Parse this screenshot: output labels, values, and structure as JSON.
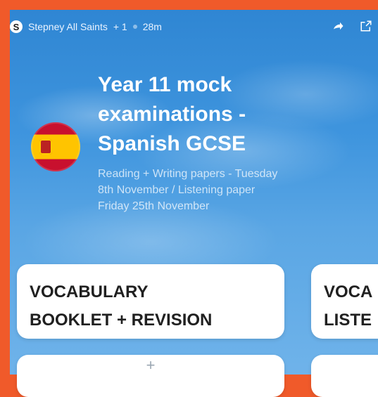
{
  "header": {
    "school": "Stepney All Saints",
    "member_badge": "+ 1",
    "time_ago": "28m"
  },
  "icons": [
    "share-icon",
    "open-external-icon"
  ],
  "post": {
    "title_line1": "Year 11 mock",
    "title_line2": "examinations -",
    "title_line3": "Spanish GCSE",
    "subtitle_line1": "Reading + Writing papers - Tuesday",
    "subtitle_line2": "8th November / Listening paper",
    "subtitle_line3": "Friday 25th November"
  },
  "cards": [
    {
      "line1": "VOCABULARY",
      "line2": "BOOKLET + REVISION"
    },
    {
      "line1": "VOCA",
      "line2": "LISTE"
    }
  ],
  "add_card": {
    "symbol": "+"
  },
  "colors": {
    "frame": "#f05a2a",
    "sky_top": "#2f86d3",
    "sky_bottom": "#6fb3ea",
    "card_bg": "#ffffff",
    "text_dark": "#202020"
  }
}
